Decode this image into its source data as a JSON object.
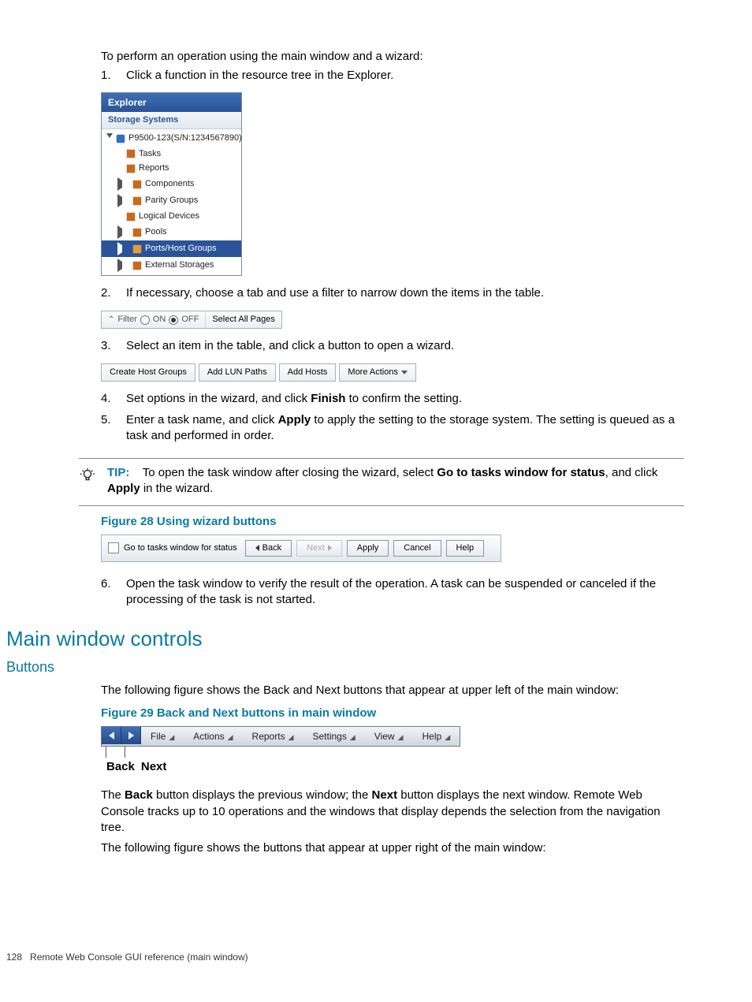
{
  "intro": {
    "line1": "To perform an operation using the main window and a wizard:",
    "step1": "Click a function in the resource tree in the Explorer."
  },
  "explorer": {
    "title": "Explorer",
    "subtitle": "Storage Systems",
    "root": "P9500-123(S/N:1234567890)",
    "items": [
      "Tasks",
      "Reports",
      "Components",
      "Parity Groups",
      "Logical Devices",
      "Pools",
      "Ports/Host Groups",
      "External Storages"
    ]
  },
  "step2": "If necessary, choose a tab and use a filter to narrow down the items in the table.",
  "filter": {
    "label": "Filter",
    "on": "ON",
    "off": "OFF",
    "select_all": "Select All Pages"
  },
  "step3": "Select an item in the table, and click a button to open a wizard.",
  "buttons": {
    "b1": "Create Host Groups",
    "b2": "Add LUN Paths",
    "b3": "Add Hosts",
    "b4": "More Actions"
  },
  "step4": {
    "pre": "Set options in the wizard, and click ",
    "bold": "Finish",
    "post": " to confirm the setting."
  },
  "step5": {
    "pre": "Enter a task name, and click ",
    "bold": "Apply",
    "post": " to apply the setting to the storage system. The setting is queued as a task and performed in order."
  },
  "tip": {
    "label": "TIP:",
    "t1": "To open the task window after closing the wizard, select ",
    "b1": "Go to tasks window for status",
    "t2": ", and click ",
    "b2": "Apply",
    "t3": " in the wizard."
  },
  "fig28": {
    "caption": "Figure 28 Using wizard buttons",
    "checkbox_label": "Go to tasks window for status",
    "back": "Back",
    "next": "Next",
    "apply": "Apply",
    "cancel": "Cancel",
    "help": "Help"
  },
  "step6": "Open the task window to verify the result of the operation. A task can be suspended or canceled if the processing of the task is not started.",
  "h2": "Main window controls",
  "h3": "Buttons",
  "buttons_intro": "The following figure shows the Back and Next buttons that appear at upper left of the main window:",
  "fig29": {
    "caption": "Figure 29 Back and Next buttons in main window",
    "menus": [
      "File",
      "Actions",
      "Reports",
      "Settings",
      "View",
      "Help"
    ],
    "back": "Back",
    "next": "Next"
  },
  "para_backnext": {
    "t1": "The ",
    "b1": "Back",
    "t2": " button displays the previous window; the ",
    "b2": "Next",
    "t3": " button displays the next window. Remote Web Console tracks up to 10 operations and the windows that display depends the selection from the navigation tree."
  },
  "para_upper_right": "The following figure shows the buttons that appear at upper right of the main window:",
  "footer": {
    "page": "128",
    "title": "Remote Web Console GUI reference (main window)"
  }
}
